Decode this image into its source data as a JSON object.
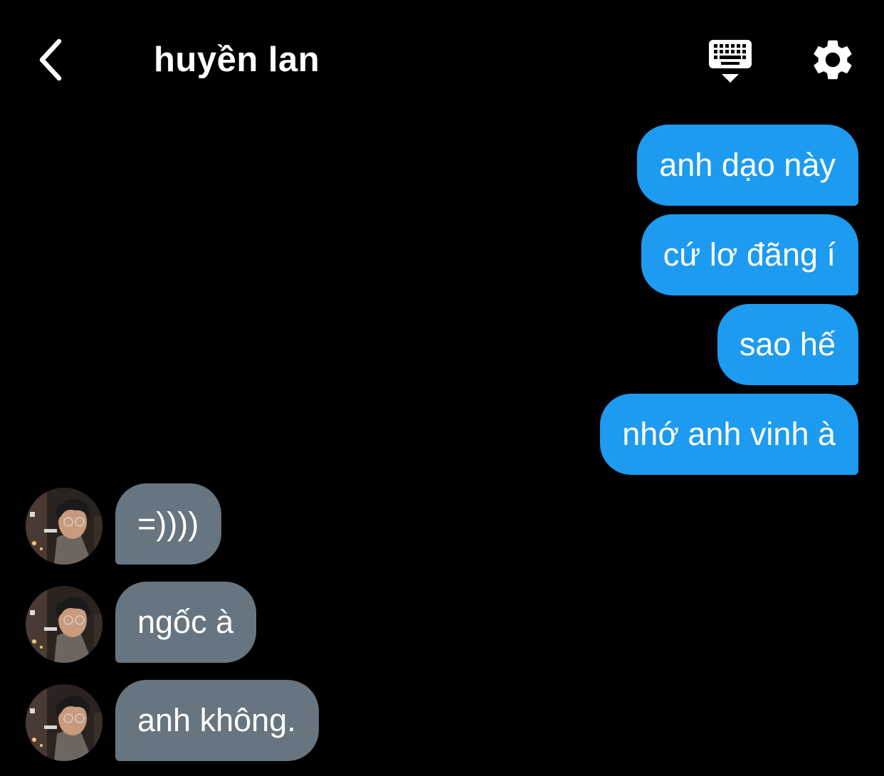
{
  "header": {
    "title": "huyền lan",
    "back_icon": "chevron-left-icon",
    "keyboard_icon": "keyboard-hide-icon",
    "settings_icon": "gear-icon"
  },
  "colors": {
    "background": "#000000",
    "outgoing_bubble": "#1D9BF0",
    "incoming_bubble": "#66757F",
    "text": "#FFFFFF"
  },
  "messages": [
    {
      "direction": "outgoing",
      "text": "anh dạo này"
    },
    {
      "direction": "outgoing",
      "text": "cứ lơ đãng í"
    },
    {
      "direction": "outgoing",
      "text": "sao hế"
    },
    {
      "direction": "outgoing",
      "text": "nhớ anh vinh à"
    },
    {
      "direction": "incoming",
      "text": "=))))"
    },
    {
      "direction": "incoming",
      "text": "ngốc à"
    },
    {
      "direction": "incoming",
      "text": "anh không."
    }
  ]
}
